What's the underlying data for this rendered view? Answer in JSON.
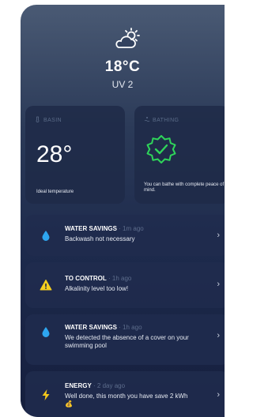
{
  "weather": {
    "icon": "cloud-sun-icon",
    "temperature": "18°C",
    "uv": "UV 2"
  },
  "basin": {
    "label": "BASIN",
    "temperature": "28°",
    "caption": "Ideal temperature"
  },
  "bathing": {
    "label": "BATHING",
    "icon": "check-badge-icon",
    "caption": "You can bathe with complete peace of mind."
  },
  "notifications": [
    {
      "title": "WATER SAVINGS",
      "time": "· 1m ago",
      "body": "Backwash not necessary",
      "icon": "water-drop-icon"
    },
    {
      "title": "TO CONTROL",
      "time": "· 1h ago",
      "body": "Alkalinity level too low!",
      "icon": "warning-icon"
    },
    {
      "title": "WATER SAVINGS",
      "time": "· 1h ago",
      "body": "We detected the absence of a cover on your swimming pool",
      "icon": "water-drop-icon"
    },
    {
      "title": "ENERGY",
      "time": "· 2 day ago",
      "body": "Well done, this month you have save 2 kWh 💰",
      "icon": "lightning-icon"
    }
  ],
  "colors": {
    "accent_green": "#2fd45a",
    "water_blue": "#2ea6f0",
    "warning_yellow": "#f4cf1e",
    "energy_yellow": "#f6c81a"
  }
}
